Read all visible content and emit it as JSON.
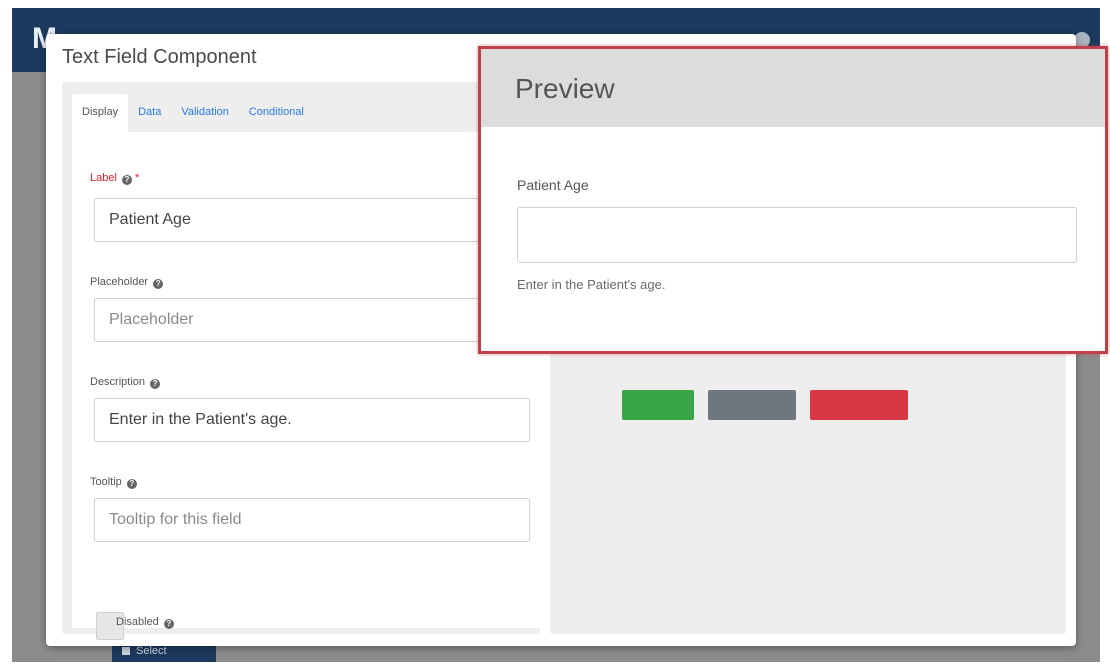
{
  "modal": {
    "title": "Text Field Component",
    "tabs": [
      {
        "label": "Display",
        "active": true
      },
      {
        "label": "Data",
        "active": false
      },
      {
        "label": "Validation",
        "active": false
      },
      {
        "label": "Conditional",
        "active": false
      }
    ]
  },
  "form": {
    "label_field": {
      "label": "Label",
      "required_mark": "*",
      "value": "Patient Age"
    },
    "placeholder_field": {
      "label": "Placeholder",
      "placeholder": "Placeholder"
    },
    "description_field": {
      "label": "Description",
      "value": "Enter in the Patient's age."
    },
    "tooltip_field": {
      "label": "Tooltip",
      "placeholder": "Tooltip for this field"
    },
    "disabled_checkbox": {
      "label": "Disabled",
      "checked": false
    }
  },
  "preview": {
    "title": "Preview",
    "field_label": "Patient Age",
    "field_description": "Enter in the Patient's age."
  },
  "background": {
    "select_button_label": "Select"
  },
  "colors": {
    "header_bg": "#1c3a5e",
    "accent_blue": "#2a7ae2",
    "required_red": "#d9232d",
    "preview_border": "#c2404a",
    "save_green": "#3aa546",
    "cancel_gray": "#6e7680",
    "remove_red": "#d93646"
  },
  "icons": {
    "help": "question-circle-icon",
    "select": "select-square-icon"
  }
}
